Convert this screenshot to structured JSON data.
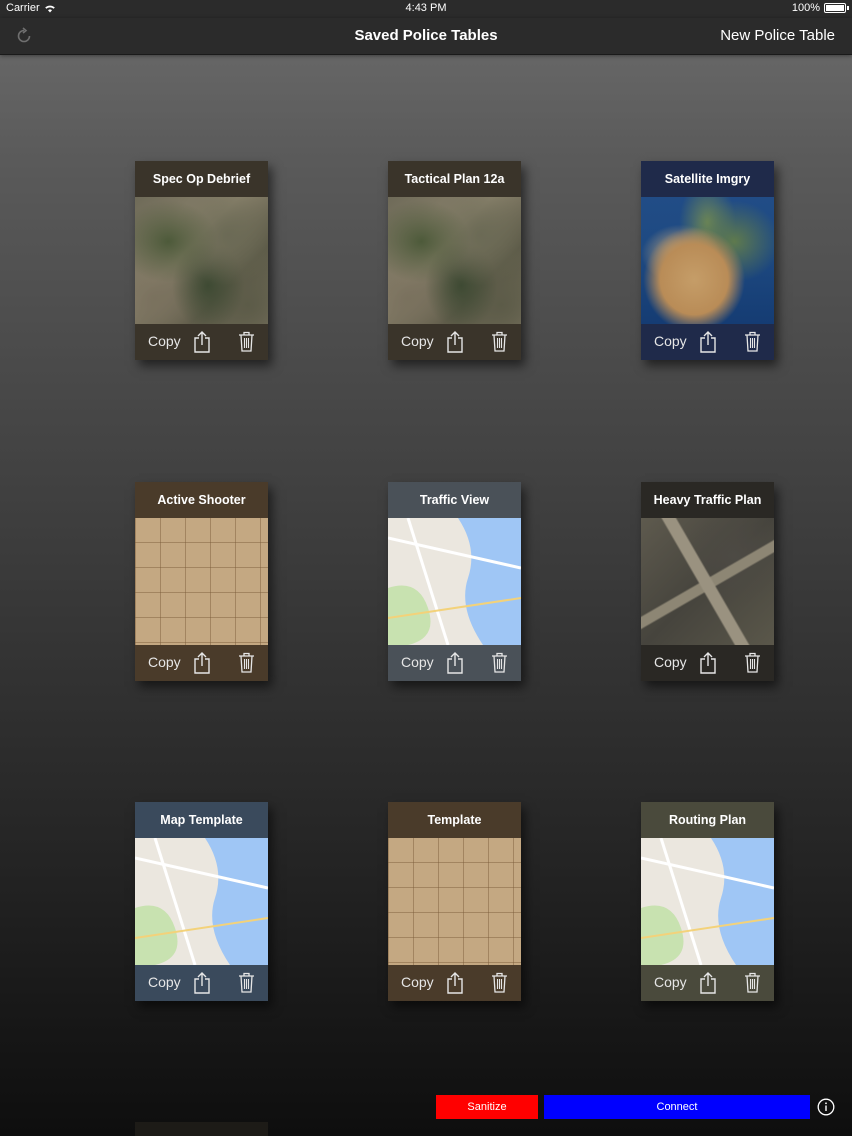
{
  "status_bar": {
    "carrier": "Carrier",
    "time": "4:43 PM",
    "battery": "100%"
  },
  "nav": {
    "title": "Saved Police Tables",
    "new_button": "New Police Table",
    "refresh_icon": "refresh-icon"
  },
  "cards": [
    {
      "title": "Spec Op Debrief",
      "theme": "#3a342a",
      "thumb": "terrain"
    },
    {
      "title": "Tactical Plan 12a",
      "theme": "#3a342a",
      "thumb": "terrain"
    },
    {
      "title": "Satellite Imgry",
      "theme": "#1f2a4a",
      "thumb": "satellite"
    },
    {
      "title": "Active Shooter",
      "theme": "#4a3b2a",
      "thumb": "grid"
    },
    {
      "title": "Traffic View",
      "theme": "#4a5158",
      "thumb": "map"
    },
    {
      "title": "Heavy Traffic Plan",
      "theme": "#2a2824",
      "thumb": "aerial"
    },
    {
      "title": "Map Template",
      "theme": "#3a4a5c",
      "thumb": "map"
    },
    {
      "title": "Template",
      "theme": "#4a3b2a",
      "thumb": "grid"
    },
    {
      "title": "Routing Plan",
      "theme": "#4a4a3c",
      "thumb": "map"
    }
  ],
  "card_actions": {
    "copy": "Copy",
    "share_icon": "share-icon",
    "trash_icon": "trash-icon"
  },
  "bottom_bar": {
    "sanitize": "Sanitize",
    "sanitize_color": "#ff0000",
    "connect": "Connect",
    "connect_color": "#0000ff",
    "info_icon": "info-icon"
  }
}
